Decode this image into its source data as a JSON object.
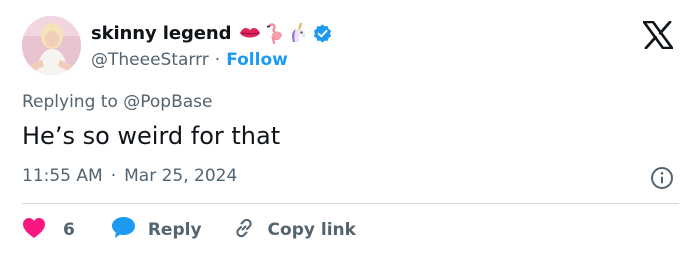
{
  "author": {
    "display_name": "skinny legend",
    "handle": "@TheeeStarrr",
    "follow_label": "Follow",
    "emojis": [
      "lips-icon",
      "flamingo-icon",
      "unicorn-icon"
    ],
    "verified_icon": "verified-badge-icon"
  },
  "tweet": {
    "replying_prefix": "Replying to ",
    "replying_to": "@PopBase",
    "text": "He’s so weird for that",
    "time": "11:55 AM",
    "date": "Mar 25, 2024"
  },
  "actions": {
    "like_count": "6",
    "reply_label": "Reply",
    "copy_link_label": "Copy link"
  },
  "colors": {
    "accent": "#1d9bf0",
    "like": "#f91880",
    "secondary_text": "#536471",
    "primary_text": "#0f1419"
  }
}
